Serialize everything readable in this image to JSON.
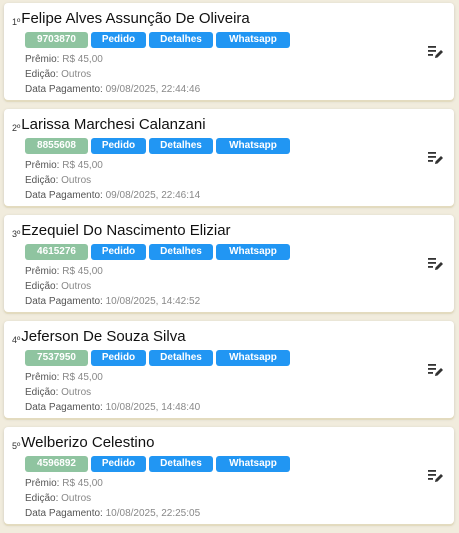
{
  "labels": {
    "pedido": "Pedido",
    "detalhes": "Detalhes",
    "whatsapp": "Whatsapp",
    "premio": "Prêmio:",
    "edicao": "Edição:",
    "data_pagamento": "Data Pagamento:"
  },
  "icons": {
    "edit": "edit-list-icon"
  },
  "colors": {
    "code_badge": "#8fc4a0",
    "button": "#2196f3",
    "background": "#f1ecdd"
  },
  "winners": [
    {
      "rank": "1º",
      "name": "Felipe Alves Assunção De Oliveira",
      "code": "9703870",
      "premio": "R$ 45,00",
      "edicao": "Outros",
      "data_pagamento": "09/08/2025, 22:44:46"
    },
    {
      "rank": "2º",
      "name": "Larissa Marchesi Calanzani",
      "code": "8855608",
      "premio": "R$ 45,00",
      "edicao": "Outros",
      "data_pagamento": "09/08/2025, 22:46:14"
    },
    {
      "rank": "3º",
      "name": "Ezequiel Do Nascimento Eliziar",
      "code": "4615276",
      "premio": "R$ 45,00",
      "edicao": "Outros",
      "data_pagamento": "10/08/2025, 14:42:52"
    },
    {
      "rank": "4º",
      "name": "Jeferson De Souza Silva",
      "code": "7537950",
      "premio": "R$ 45,00",
      "edicao": "Outros",
      "data_pagamento": "10/08/2025, 14:48:40"
    },
    {
      "rank": "5º",
      "name": "Welberizo Celestino",
      "code": "4596892",
      "premio": "R$ 45,00",
      "edicao": "Outros",
      "data_pagamento": "10/08/2025, 22:25:05"
    }
  ]
}
